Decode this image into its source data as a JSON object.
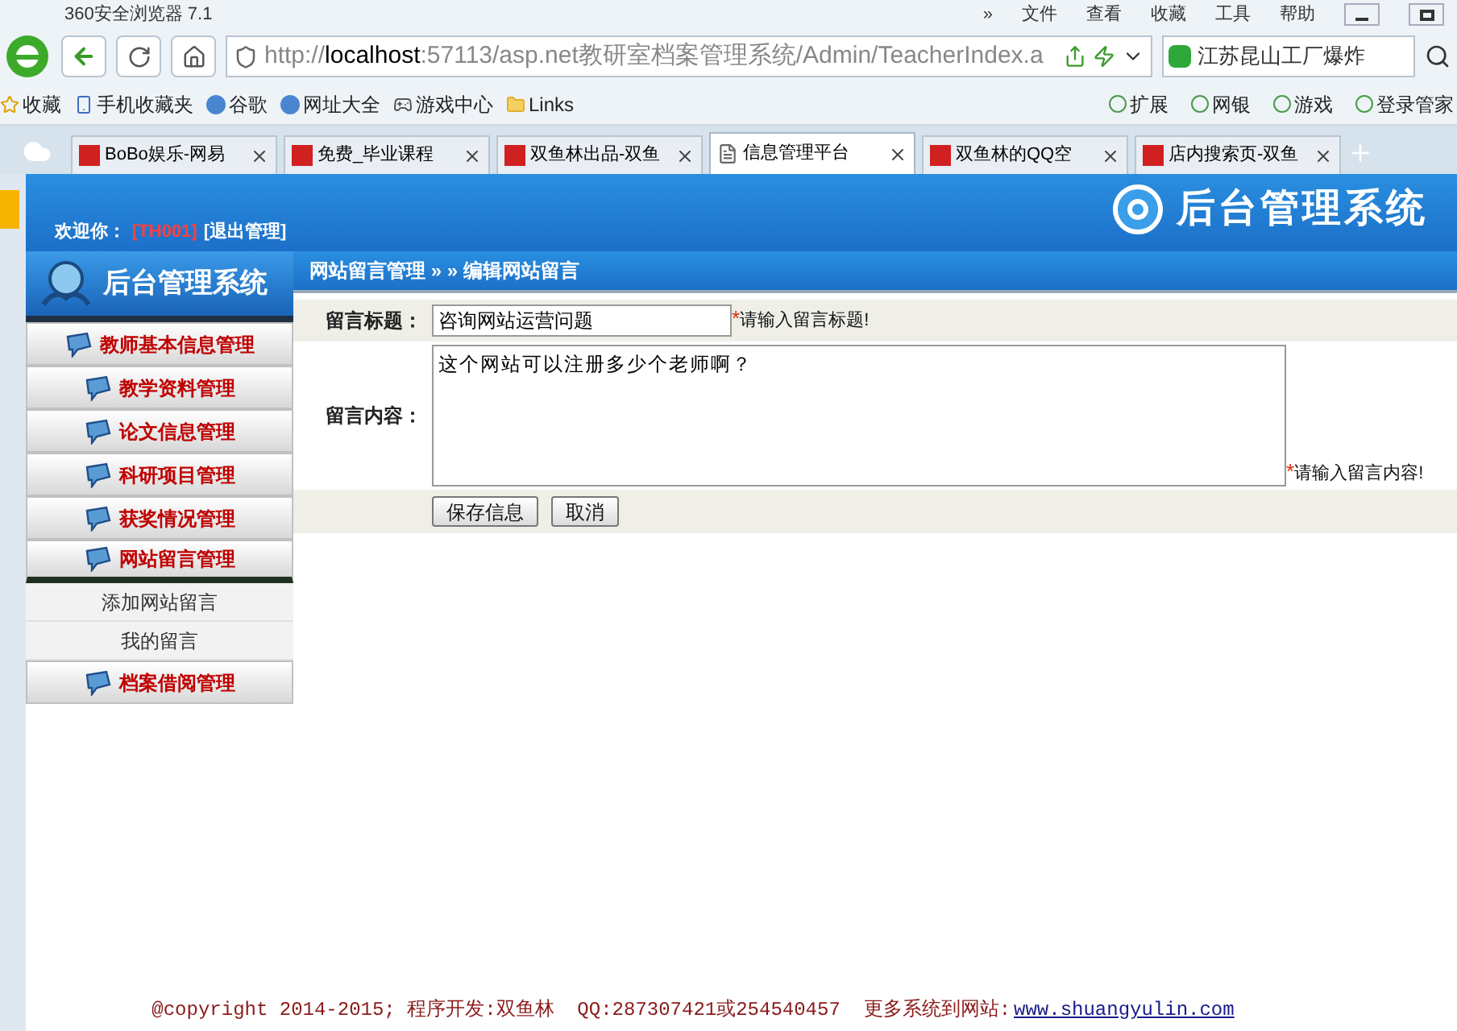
{
  "browser": {
    "title": "360安全浏览器 7.1",
    "menu": [
      "»",
      "文件",
      "查看",
      "收藏",
      "工具",
      "帮助"
    ],
    "address": {
      "prefix": "http://",
      "host": "localhost",
      "rest": ":57113/asp.net教研室档案管理系统/Admin/TeacherIndex.a"
    },
    "search": {
      "value": "江苏昆山工厂爆炸"
    },
    "bookmarks": [
      "收藏",
      "手机收藏夹",
      "谷歌",
      "网址大全",
      "游戏中心",
      "Links"
    ],
    "bookmarks_right": [
      "扩展",
      "网银",
      "游戏",
      "登录管家"
    ],
    "tabs": [
      {
        "label": "BoBo娱乐-网易",
        "selected": false
      },
      {
        "label": "免费_毕业课程",
        "selected": false
      },
      {
        "label": "双鱼林出品-双鱼",
        "selected": false
      },
      {
        "label": "信息管理平台",
        "selected": true
      },
      {
        "label": "双鱼林的QQ空",
        "selected": false
      },
      {
        "label": "店内搜索页-双鱼",
        "selected": false
      }
    ]
  },
  "page": {
    "header": {
      "welcome": "欢迎你：",
      "user": "[TH001]",
      "logout": "[退出管理]",
      "logo": "后台管理系统"
    },
    "sidebar": {
      "logo": "后台管理系统",
      "items": [
        {
          "label": "教师基本信息管理",
          "expanded": false
        },
        {
          "label": "教学资料管理",
          "expanded": false
        },
        {
          "label": "论文信息管理",
          "expanded": false
        },
        {
          "label": "科研项目管理",
          "expanded": false
        },
        {
          "label": "获奖情况管理",
          "expanded": false
        },
        {
          "label": "网站留言管理",
          "expanded": true,
          "children": [
            {
              "label": "添加网站留言"
            },
            {
              "label": "我的留言"
            }
          ]
        },
        {
          "label": "档案借阅管理",
          "expanded": false
        }
      ]
    },
    "breadcrumb": "网站留言管理 » » 编辑网站留言",
    "form": {
      "fields": [
        {
          "kind": "text",
          "label": "留言标题：",
          "value": "咨询网站运营问题",
          "required_mark": "*",
          "hint": "请输入留言标题!"
        },
        {
          "kind": "textarea",
          "label": "留言内容：",
          "value": "这个网站可以注册多少个老师啊？",
          "required_mark": "*",
          "hint": "请输入留言内容!"
        }
      ],
      "buttons": [
        "保存信息",
        "取消"
      ]
    },
    "footer": {
      "text": "@copyright 2014-2015; 程序开发:双鱼林  QQ:287307421或254540457  更多系统到网站:",
      "link": "www.shuangyulin.com"
    }
  }
}
